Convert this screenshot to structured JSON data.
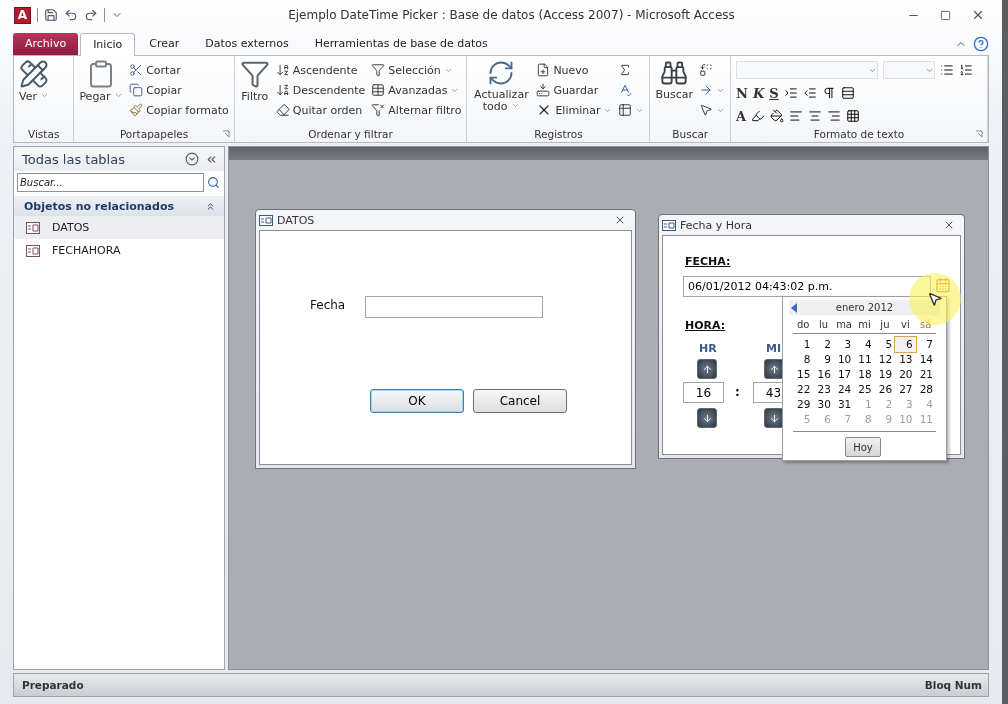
{
  "window": {
    "app_letter": "A",
    "title": "Ejemplo DateTime Picker : Base de datos (Access 2007)  -  Microsoft Access"
  },
  "tabs": [
    {
      "label": "Archivo",
      "kind": "file",
      "selected": false
    },
    {
      "label": "Inicio",
      "kind": "tab",
      "selected": true
    },
    {
      "label": "Crear",
      "kind": "tab",
      "selected": false
    },
    {
      "label": "Datos externos",
      "kind": "tab",
      "selected": false
    },
    {
      "label": "Herramientas de base de datos",
      "kind": "tab",
      "selected": false
    }
  ],
  "ribbon": [
    {
      "title": "Vistas",
      "launcher": false,
      "columns": [
        {
          "kind": "large",
          "label": "Ver",
          "dropdown": true
        }
      ]
    },
    {
      "title": "Portapapeles",
      "launcher": true,
      "columns": [
        {
          "kind": "large",
          "label": "Pegar",
          "dropdown": true
        },
        {
          "kind": "stack",
          "items": [
            {
              "label": "Cortar",
              "dropdown": false
            },
            {
              "label": "Copiar",
              "dropdown": false
            },
            {
              "label": "Copiar formato",
              "dropdown": false
            }
          ]
        }
      ]
    },
    {
      "title": "Ordenar y filtrar",
      "launcher": false,
      "columns": [
        {
          "kind": "large",
          "label": "Filtro",
          "dropdown": false
        },
        {
          "kind": "stack",
          "items": [
            {
              "label": "Ascendente",
              "dropdown": false
            },
            {
              "label": "Descendente",
              "dropdown": false
            },
            {
              "label": "Quitar orden",
              "dropdown": false
            }
          ]
        },
        {
          "kind": "stack",
          "items": [
            {
              "label": "Selección",
              "dropdown": true
            },
            {
              "label": "Avanzadas",
              "dropdown": true
            },
            {
              "label": "Alternar filtro",
              "dropdown": false
            }
          ]
        }
      ]
    },
    {
      "title": "Registros",
      "launcher": false,
      "columns": [
        {
          "kind": "large",
          "label": "Actualizar todo",
          "dropdown": true
        },
        {
          "kind": "stack",
          "items": [
            {
              "label": "Nuevo",
              "dropdown": false
            },
            {
              "label": "Guardar",
              "dropdown": false
            },
            {
              "label": "Eliminar",
              "dropdown": true
            }
          ]
        },
        {
          "kind": "stack",
          "items": [
            {
              "dropdown": false
            },
            {
              "dropdown": false
            },
            {
              "dropdown": true
            }
          ]
        }
      ]
    },
    {
      "title": "Buscar",
      "launcher": false,
      "columns": [
        {
          "kind": "large",
          "label": "Buscar",
          "dropdown": false
        },
        {
          "kind": "stack",
          "items": [
            {
              "dropdown": false
            },
            {
              "dropdown": true
            },
            {
              "dropdown": true
            }
          ]
        }
      ]
    },
    {
      "title": "Formato de texto",
      "launcher": true,
      "columns": [
        {
          "kind": "format",
          "letters": [
            "N",
            "K",
            "S"
          ],
          "color_letter": "A"
        }
      ]
    }
  ],
  "nav_pane": {
    "title": "Todas las tablas",
    "search_placeholder": "Buscar...",
    "group": {
      "label": "Objetos no relacionados",
      "expanded": true
    },
    "items": [
      {
        "label": "DATOS",
        "selected": true
      },
      {
        "label": "FECHAHORA",
        "selected": false
      }
    ]
  },
  "datos_form": {
    "title": "DATOS",
    "field_label": "Fecha",
    "buttons": [
      {
        "label": "OK",
        "default": true
      },
      {
        "label": "Cancel",
        "default": false
      }
    ]
  },
  "fecha_form": {
    "title": "Fecha y Hora",
    "date_label": "FECHA:",
    "date_value": "06/01/2012 04:43:02 p.m.",
    "time_label": "HORA:",
    "time_columns": [
      {
        "label": "HR",
        "value": "16"
      },
      {
        "label": "MI",
        "value": "43"
      }
    ],
    "separator": ":"
  },
  "calendar": {
    "month": "enero 2012",
    "weekdays": [
      "do",
      "lu",
      "ma",
      "mi",
      "ju",
      "vi",
      "sá"
    ],
    "days": [
      {
        "label": "1",
        "muted": false,
        "selected": false
      },
      {
        "label": "2",
        "muted": false,
        "selected": false
      },
      {
        "label": "3",
        "muted": false,
        "selected": false
      },
      {
        "label": "4",
        "muted": false,
        "selected": false
      },
      {
        "label": "5",
        "muted": false,
        "selected": false
      },
      {
        "label": "6",
        "muted": false,
        "selected": true
      },
      {
        "label": "7",
        "muted": false,
        "selected": false
      },
      {
        "label": "8",
        "muted": false,
        "selected": false
      },
      {
        "label": "9",
        "muted": false,
        "selected": false
      },
      {
        "label": "10",
        "muted": false,
        "selected": false
      },
      {
        "label": "11",
        "muted": false,
        "selected": false
      },
      {
        "label": "12",
        "muted": false,
        "selected": false
      },
      {
        "label": "13",
        "muted": false,
        "selected": false
      },
      {
        "label": "14",
        "muted": false,
        "selected": false
      },
      {
        "label": "15",
        "muted": false,
        "selected": false
      },
      {
        "label": "16",
        "muted": false,
        "selected": false
      },
      {
        "label": "17",
        "muted": false,
        "selected": false
      },
      {
        "label": "18",
        "muted": false,
        "selected": false
      },
      {
        "label": "19",
        "muted": false,
        "selected": false
      },
      {
        "label": "20",
        "muted": false,
        "selected": false
      },
      {
        "label": "21",
        "muted": false,
        "selected": false
      },
      {
        "label": "22",
        "muted": false,
        "selected": false
      },
      {
        "label": "23",
        "muted": false,
        "selected": false
      },
      {
        "label": "24",
        "muted": false,
        "selected": false
      },
      {
        "label": "25",
        "muted": false,
        "selected": false
      },
      {
        "label": "26",
        "muted": false,
        "selected": false
      },
      {
        "label": "27",
        "muted": false,
        "selected": false
      },
      {
        "label": "28",
        "muted": false,
        "selected": false
      },
      {
        "label": "29",
        "muted": false,
        "selected": false
      },
      {
        "label": "30",
        "muted": false,
        "selected": false
      },
      {
        "label": "31",
        "muted": false,
        "selected": false
      },
      {
        "label": "1",
        "muted": true,
        "selected": false
      },
      {
        "label": "2",
        "muted": true,
        "selected": false
      },
      {
        "label": "3",
        "muted": true,
        "selected": false
      },
      {
        "label": "4",
        "muted": true,
        "selected": false
      },
      {
        "label": "5",
        "muted": true,
        "selected": false
      },
      {
        "label": "6",
        "muted": true,
        "selected": false
      },
      {
        "label": "7",
        "muted": true,
        "selected": false
      },
      {
        "label": "8",
        "muted": true,
        "selected": false
      },
      {
        "label": "9",
        "muted": true,
        "selected": false
      },
      {
        "label": "10",
        "muted": true,
        "selected": false
      },
      {
        "label": "11",
        "muted": true,
        "selected": false
      }
    ],
    "today_button": "Hoy"
  },
  "status_bar": {
    "left": "Preparado",
    "right": "Bloq Num"
  }
}
